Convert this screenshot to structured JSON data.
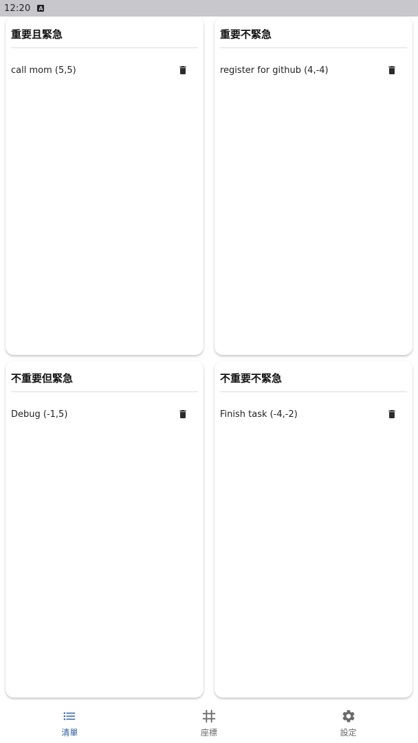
{
  "status_bar": {
    "time": "12:20",
    "indicator": "A"
  },
  "quadrants": [
    {
      "title": "重要且緊急",
      "tasks": [
        {
          "text": "call mom (5,5)"
        }
      ]
    },
    {
      "title": "重要不緊急",
      "tasks": [
        {
          "text": "register for github (4,-4)"
        }
      ]
    },
    {
      "title": "不重要但緊急",
      "tasks": [
        {
          "text": "Debug (-1,5)"
        }
      ]
    },
    {
      "title": "不重要不緊急",
      "tasks": [
        {
          "text": "Finish task (-4,-2)"
        }
      ]
    }
  ],
  "bottom_nav": {
    "items": [
      {
        "label": "清單",
        "icon": "list-icon",
        "active": true
      },
      {
        "label": "座標",
        "icon": "grid-icon",
        "active": false
      },
      {
        "label": "設定",
        "icon": "gear-icon",
        "active": false
      }
    ]
  },
  "colors": {
    "accent": "#2f5fa0",
    "inactive": "#6b6b6b",
    "status_bar_bg": "#c8c8cc"
  }
}
